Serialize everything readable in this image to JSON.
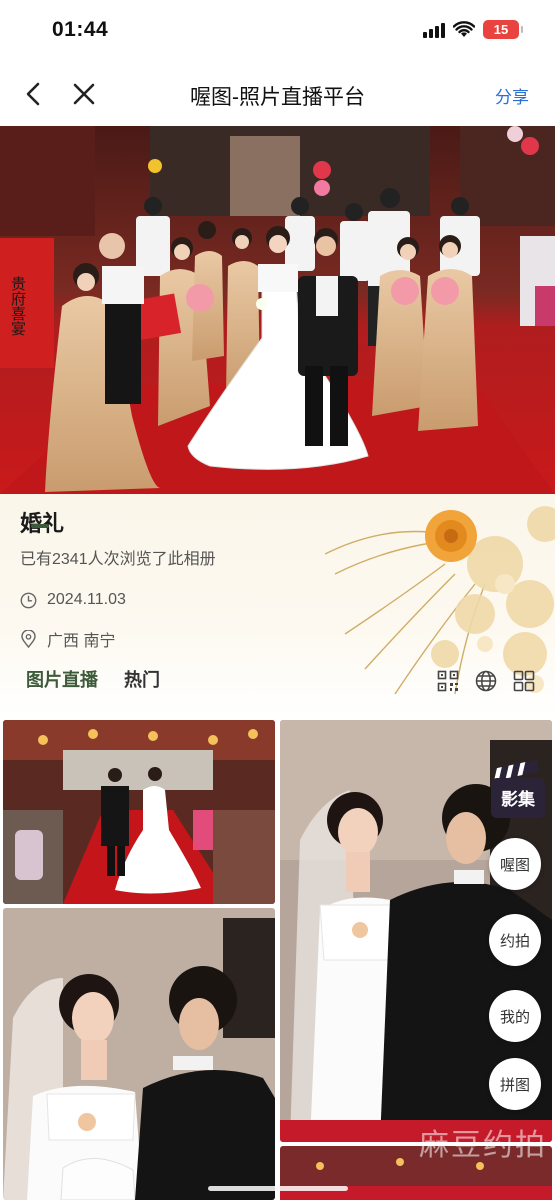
{
  "status": {
    "time": "01:44",
    "battery": "15"
  },
  "nav": {
    "title": "喔图-照片直播平台",
    "share": "分享",
    "back_icon": "chevron-left-icon",
    "close_icon": "close-icon"
  },
  "album": {
    "title": "婚礼",
    "views": "已有2341人次浏览了此相册",
    "date": "2024.11.03",
    "location": "广西 南宁",
    "hero_plaque_text": "贵府喜宴"
  },
  "tabs": [
    {
      "label": "图片直播",
      "active": true
    },
    {
      "label": "热门",
      "active": false
    }
  ],
  "tools": [
    "qr-code-icon",
    "globe-icon",
    "grid-icon"
  ],
  "float_menu": {
    "logo_text": "影集",
    "items": [
      "喔图",
      "约拍",
      "我的",
      "拼图"
    ]
  },
  "watermark": "麻豆约拍",
  "colors": {
    "accent": "#3d5a3a",
    "link": "#2a6fd6",
    "carpet": "#c41a1c",
    "battery": "#e8433e"
  }
}
